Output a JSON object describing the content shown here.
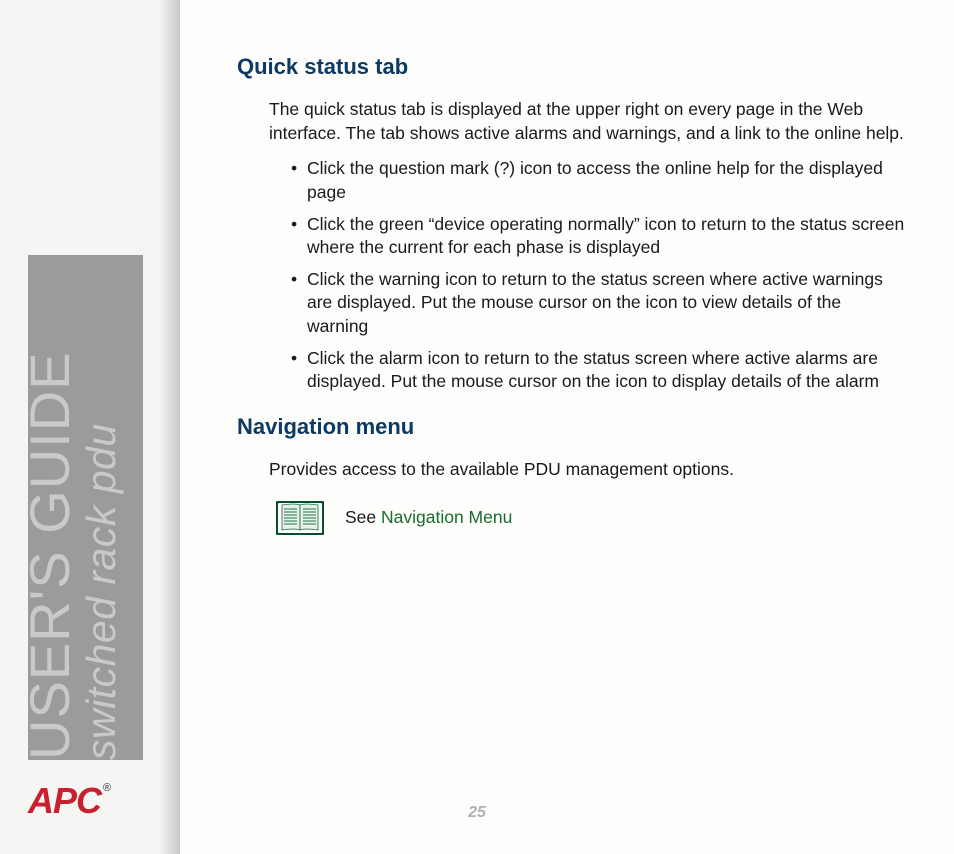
{
  "sidebar": {
    "title_line1": "USER'S GUIDE",
    "title_line2": "switched rack pdu"
  },
  "logo": {
    "text": "APC",
    "registered": "®"
  },
  "content": {
    "heading1": "Quick status tab",
    "intro": "The quick status tab is displayed at the upper right on every page in the Web interface. The tab shows active alarms and warnings, and a link to the online help.",
    "bullets": [
      "Click the question mark (?) icon to access the online help for the displayed page",
      "Click the green “device operating normally” icon to return to the status screen where the current for each phase is displayed",
      "Click the warning icon to return to the status screen where active warnings are displayed. Put the mouse cursor on the icon to view details of the warning",
      "Click the alarm icon to return to the status screen where active alarms are displayed. Put the mouse cursor on the icon to display details of the alarm"
    ],
    "heading2": "Navigation menu",
    "nav_body": "Provides access to the available PDU management options.",
    "see_prefix": "See ",
    "see_link": "Navigation Menu"
  },
  "page_number": "25"
}
